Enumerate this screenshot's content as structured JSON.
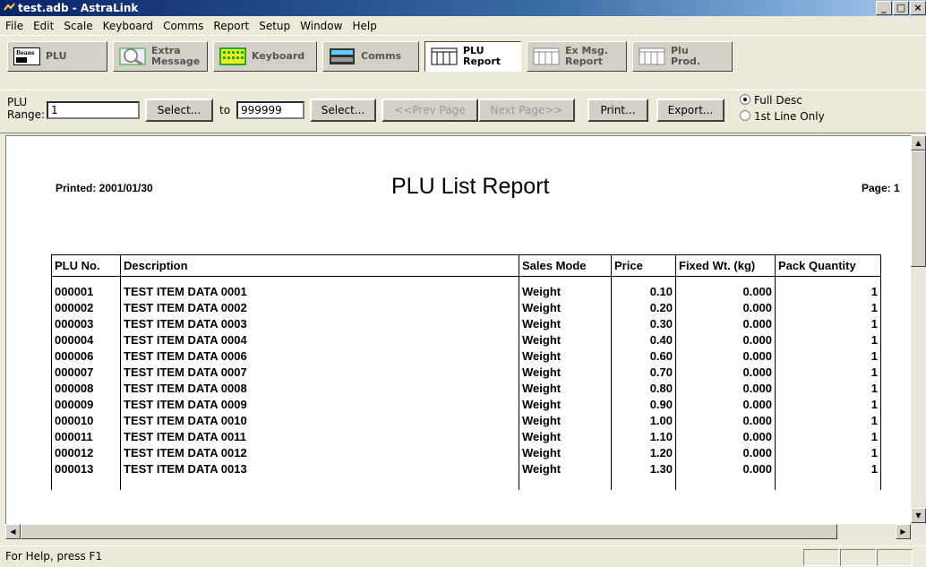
{
  "window": {
    "title": "test.adb - AstraLink",
    "min": "_",
    "max": "□",
    "close": "×"
  },
  "menu": [
    "File",
    "Edit",
    "Scale",
    "Keyboard",
    "Comms",
    "Report",
    "Setup",
    "Window",
    "Help"
  ],
  "func_tabs": [
    {
      "label1": "PLU",
      "label2": "",
      "active": false,
      "icon": "price-label-icon",
      "icon_text": "Beans"
    },
    {
      "label1": "Extra",
      "label2": "Message",
      "active": false,
      "icon": "magnifier-icon"
    },
    {
      "label1": "Keyboard",
      "label2": "",
      "active": false,
      "icon": "keyboard-icon"
    },
    {
      "label1": "Comms",
      "label2": "",
      "active": false,
      "icon": "scale-comms-icon"
    },
    {
      "label1": "PLU",
      "label2": "Report",
      "active": true,
      "icon": "report-icon"
    },
    {
      "label1": "Ex Msg.",
      "label2": "Report",
      "active": false,
      "icon": "report-icon"
    },
    {
      "label1": "Plu",
      "label2": "Prod.",
      "active": false,
      "icon": "report-icon"
    }
  ],
  "range": {
    "label_line1": "PLU",
    "label_line2": "Range:",
    "from_value": "1",
    "to_label": "to",
    "to_value": "999999",
    "select_label": "Select...",
    "prev_page": "<<Prev Page",
    "next_page": "Next Page>>",
    "print": "Print...",
    "export": "Export...",
    "radio_full": "Full Desc",
    "radio_first": "1st Line Only",
    "selected": "full"
  },
  "report": {
    "printed": "Printed: 2001/01/30",
    "title": "PLU List Report",
    "page": "Page: 1",
    "columns": [
      "PLU No.",
      "Description",
      "Sales Mode",
      "Price",
      "Fixed Wt. (kg)",
      "Pack Quantity"
    ],
    "rows": [
      [
        "000001",
        "TEST ITEM DATA 0001",
        "Weight",
        "0.10",
        "0.000",
        "1"
      ],
      [
        "000002",
        "TEST ITEM DATA 0002",
        "Weight",
        "0.20",
        "0.000",
        "1"
      ],
      [
        "000003",
        "TEST ITEM DATA 0003",
        "Weight",
        "0.30",
        "0.000",
        "1"
      ],
      [
        "000004",
        "TEST ITEM DATA 0004",
        "Weight",
        "0.40",
        "0.000",
        "1"
      ],
      [
        "000006",
        "TEST ITEM DATA 0006",
        "Weight",
        "0.60",
        "0.000",
        "1"
      ],
      [
        "000007",
        "TEST ITEM DATA 0007",
        "Weight",
        "0.70",
        "0.000",
        "1"
      ],
      [
        "000008",
        "TEST ITEM DATA 0008",
        "Weight",
        "0.80",
        "0.000",
        "1"
      ],
      [
        "000009",
        "TEST ITEM DATA 0009",
        "Weight",
        "0.90",
        "0.000",
        "1"
      ],
      [
        "000010",
        "TEST ITEM DATA 0010",
        "Weight",
        "1.00",
        "0.000",
        "1"
      ],
      [
        "000011",
        "TEST ITEM DATA 0011",
        "Weight",
        "1.10",
        "0.000",
        "1"
      ],
      [
        "000012",
        "TEST ITEM DATA 0012",
        "Weight",
        "1.20",
        "0.000",
        "1"
      ],
      [
        "000013",
        "TEST ITEM DATA 0013",
        "Weight",
        "1.30",
        "0.000",
        "1"
      ]
    ]
  },
  "status": {
    "help": "For Help, press F1"
  }
}
